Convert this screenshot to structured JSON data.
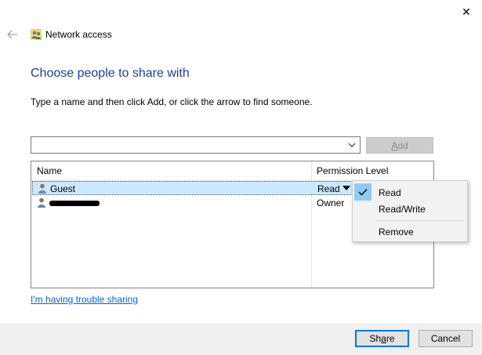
{
  "window": {
    "title": "Network access",
    "close_glyph": "✕"
  },
  "main": {
    "heading": "Choose people to share with",
    "instructions": "Type a name and then click Add, or click the arrow to find someone.",
    "name_input_value": "",
    "add_button": {
      "prefix": "",
      "accel": "A",
      "suffix": "dd"
    }
  },
  "list": {
    "columns": {
      "name": "Name",
      "permission": "Permission Level"
    },
    "rows": [
      {
        "name": "Guest",
        "permission": "Read"
      },
      {
        "name": "",
        "permission": "Owner"
      }
    ]
  },
  "permission_menu": {
    "items": [
      {
        "label": "Read",
        "checked": true
      },
      {
        "label": "Read/Write",
        "checked": false
      },
      {
        "label": "Remove",
        "checked": false
      }
    ]
  },
  "footer": {
    "trouble_link": "I'm having trouble sharing",
    "share_button": {
      "prefix": "Sh",
      "accel": "a",
      "suffix": "re"
    },
    "cancel_button": "Cancel"
  },
  "colors": {
    "heading": "#1c3f95",
    "link": "#0066cc",
    "selection": "#cce8ff",
    "menu_check": "#91c9f7",
    "default_button_border": "#0078d7"
  }
}
